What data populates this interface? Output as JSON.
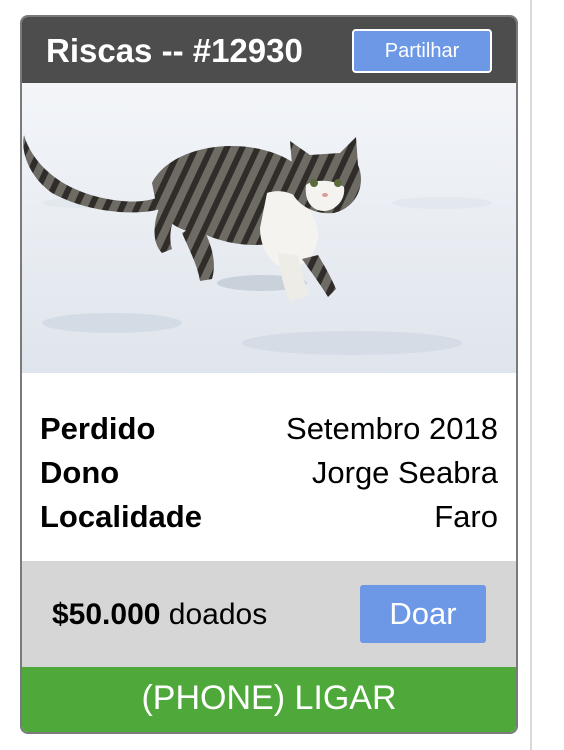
{
  "card": {
    "title": "Riscas -- #12930",
    "share_label": "Partilhar",
    "photo": {
      "subject": "tabby-white-kitten-in-snow"
    },
    "details": [
      {
        "label": "Perdido",
        "value": "Setembro 2018"
      },
      {
        "label": "Dono",
        "value": "Jorge Seabra"
      },
      {
        "label": "Localidade",
        "value": "Faro"
      }
    ],
    "donation": {
      "amount": "$50.000",
      "suffix": " doados",
      "button_label": "Doar"
    },
    "call_label": "(PHONE) LIGAR"
  },
  "colors": {
    "header_bg": "#4d4d4d",
    "accent_blue": "#6c98e6",
    "donation_bg": "#d6d6d6",
    "call_green": "#4fa93a"
  }
}
